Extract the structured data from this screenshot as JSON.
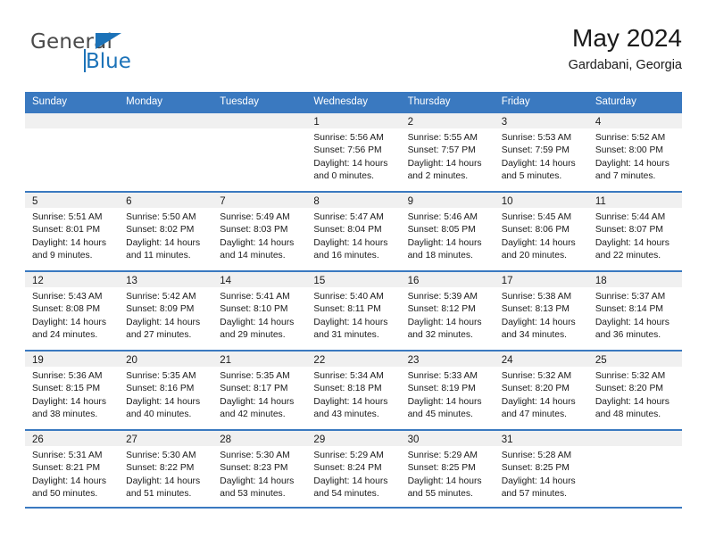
{
  "brand": {
    "name_top": "General",
    "name_bottom": "Blue",
    "accent_color": "#1b72b8",
    "triangle_icon": "brand-triangle-icon"
  },
  "header": {
    "title": "May 2024",
    "subtitle": "Gardabani, Georgia"
  },
  "theme": {
    "header_blue": "#3a79c0",
    "daynum_band": "#f0f0f0",
    "text": "#1a1a1a"
  },
  "weekdays": [
    "Sunday",
    "Monday",
    "Tuesday",
    "Wednesday",
    "Thursday",
    "Friday",
    "Saturday"
  ],
  "weeks": [
    [
      {
        "day": "",
        "lines": []
      },
      {
        "day": "",
        "lines": []
      },
      {
        "day": "",
        "lines": []
      },
      {
        "day": "1",
        "lines": [
          "Sunrise: 5:56 AM",
          "Sunset: 7:56 PM",
          "Daylight: 14 hours",
          "and 0 minutes."
        ]
      },
      {
        "day": "2",
        "lines": [
          "Sunrise: 5:55 AM",
          "Sunset: 7:57 PM",
          "Daylight: 14 hours",
          "and 2 minutes."
        ]
      },
      {
        "day": "3",
        "lines": [
          "Sunrise: 5:53 AM",
          "Sunset: 7:59 PM",
          "Daylight: 14 hours",
          "and 5 minutes."
        ]
      },
      {
        "day": "4",
        "lines": [
          "Sunrise: 5:52 AM",
          "Sunset: 8:00 PM",
          "Daylight: 14 hours",
          "and 7 minutes."
        ]
      }
    ],
    [
      {
        "day": "5",
        "lines": [
          "Sunrise: 5:51 AM",
          "Sunset: 8:01 PM",
          "Daylight: 14 hours",
          "and 9 minutes."
        ]
      },
      {
        "day": "6",
        "lines": [
          "Sunrise: 5:50 AM",
          "Sunset: 8:02 PM",
          "Daylight: 14 hours",
          "and 11 minutes."
        ]
      },
      {
        "day": "7",
        "lines": [
          "Sunrise: 5:49 AM",
          "Sunset: 8:03 PM",
          "Daylight: 14 hours",
          "and 14 minutes."
        ]
      },
      {
        "day": "8",
        "lines": [
          "Sunrise: 5:47 AM",
          "Sunset: 8:04 PM",
          "Daylight: 14 hours",
          "and 16 minutes."
        ]
      },
      {
        "day": "9",
        "lines": [
          "Sunrise: 5:46 AM",
          "Sunset: 8:05 PM",
          "Daylight: 14 hours",
          "and 18 minutes."
        ]
      },
      {
        "day": "10",
        "lines": [
          "Sunrise: 5:45 AM",
          "Sunset: 8:06 PM",
          "Daylight: 14 hours",
          "and 20 minutes."
        ]
      },
      {
        "day": "11",
        "lines": [
          "Sunrise: 5:44 AM",
          "Sunset: 8:07 PM",
          "Daylight: 14 hours",
          "and 22 minutes."
        ]
      }
    ],
    [
      {
        "day": "12",
        "lines": [
          "Sunrise: 5:43 AM",
          "Sunset: 8:08 PM",
          "Daylight: 14 hours",
          "and 24 minutes."
        ]
      },
      {
        "day": "13",
        "lines": [
          "Sunrise: 5:42 AM",
          "Sunset: 8:09 PM",
          "Daylight: 14 hours",
          "and 27 minutes."
        ]
      },
      {
        "day": "14",
        "lines": [
          "Sunrise: 5:41 AM",
          "Sunset: 8:10 PM",
          "Daylight: 14 hours",
          "and 29 minutes."
        ]
      },
      {
        "day": "15",
        "lines": [
          "Sunrise: 5:40 AM",
          "Sunset: 8:11 PM",
          "Daylight: 14 hours",
          "and 31 minutes."
        ]
      },
      {
        "day": "16",
        "lines": [
          "Sunrise: 5:39 AM",
          "Sunset: 8:12 PM",
          "Daylight: 14 hours",
          "and 32 minutes."
        ]
      },
      {
        "day": "17",
        "lines": [
          "Sunrise: 5:38 AM",
          "Sunset: 8:13 PM",
          "Daylight: 14 hours",
          "and 34 minutes."
        ]
      },
      {
        "day": "18",
        "lines": [
          "Sunrise: 5:37 AM",
          "Sunset: 8:14 PM",
          "Daylight: 14 hours",
          "and 36 minutes."
        ]
      }
    ],
    [
      {
        "day": "19",
        "lines": [
          "Sunrise: 5:36 AM",
          "Sunset: 8:15 PM",
          "Daylight: 14 hours",
          "and 38 minutes."
        ]
      },
      {
        "day": "20",
        "lines": [
          "Sunrise: 5:35 AM",
          "Sunset: 8:16 PM",
          "Daylight: 14 hours",
          "and 40 minutes."
        ]
      },
      {
        "day": "21",
        "lines": [
          "Sunrise: 5:35 AM",
          "Sunset: 8:17 PM",
          "Daylight: 14 hours",
          "and 42 minutes."
        ]
      },
      {
        "day": "22",
        "lines": [
          "Sunrise: 5:34 AM",
          "Sunset: 8:18 PM",
          "Daylight: 14 hours",
          "and 43 minutes."
        ]
      },
      {
        "day": "23",
        "lines": [
          "Sunrise: 5:33 AM",
          "Sunset: 8:19 PM",
          "Daylight: 14 hours",
          "and 45 minutes."
        ]
      },
      {
        "day": "24",
        "lines": [
          "Sunrise: 5:32 AM",
          "Sunset: 8:20 PM",
          "Daylight: 14 hours",
          "and 47 minutes."
        ]
      },
      {
        "day": "25",
        "lines": [
          "Sunrise: 5:32 AM",
          "Sunset: 8:20 PM",
          "Daylight: 14 hours",
          "and 48 minutes."
        ]
      }
    ],
    [
      {
        "day": "26",
        "lines": [
          "Sunrise: 5:31 AM",
          "Sunset: 8:21 PM",
          "Daylight: 14 hours",
          "and 50 minutes."
        ]
      },
      {
        "day": "27",
        "lines": [
          "Sunrise: 5:30 AM",
          "Sunset: 8:22 PM",
          "Daylight: 14 hours",
          "and 51 minutes."
        ]
      },
      {
        "day": "28",
        "lines": [
          "Sunrise: 5:30 AM",
          "Sunset: 8:23 PM",
          "Daylight: 14 hours",
          "and 53 minutes."
        ]
      },
      {
        "day": "29",
        "lines": [
          "Sunrise: 5:29 AM",
          "Sunset: 8:24 PM",
          "Daylight: 14 hours",
          "and 54 minutes."
        ]
      },
      {
        "day": "30",
        "lines": [
          "Sunrise: 5:29 AM",
          "Sunset: 8:25 PM",
          "Daylight: 14 hours",
          "and 55 minutes."
        ]
      },
      {
        "day": "31",
        "lines": [
          "Sunrise: 5:28 AM",
          "Sunset: 8:25 PM",
          "Daylight: 14 hours",
          "and 57 minutes."
        ]
      },
      {
        "day": "",
        "lines": []
      }
    ]
  ]
}
